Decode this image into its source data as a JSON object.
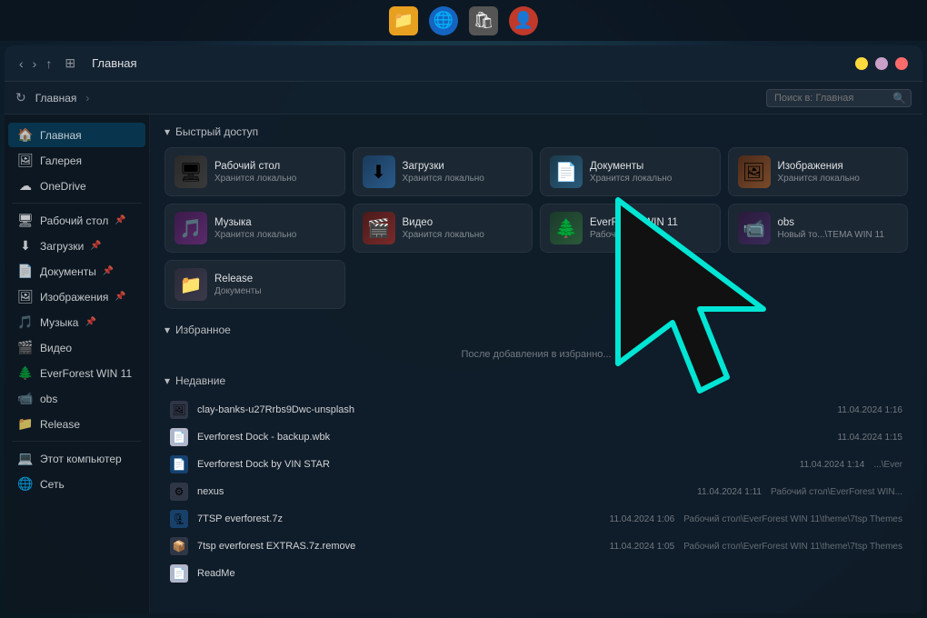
{
  "taskbar": {
    "icons": [
      {
        "name": "folder",
        "label": "📁",
        "type": "folder"
      },
      {
        "name": "edge",
        "label": "🌐",
        "type": "edge"
      },
      {
        "name": "store",
        "label": "🛍",
        "type": "store"
      },
      {
        "name": "avatar",
        "label": "👤",
        "type": "avatar"
      }
    ]
  },
  "window": {
    "title": "Главная",
    "address": "Главная",
    "search_placeholder": "Поиск в: Главная",
    "win_controls": {
      "close_color": "#ff6b6b",
      "min_color": "#ffd93d",
      "max_color": "#c8a0c8"
    }
  },
  "sidebar": {
    "items": [
      {
        "id": "home",
        "label": "Главная",
        "icon": "🏠",
        "active": true
      },
      {
        "id": "gallery",
        "label": "Галерея",
        "icon": "🖼",
        "active": false
      },
      {
        "id": "onedrive",
        "label": "OneDrive",
        "icon": "☁",
        "active": false
      }
    ],
    "pinned": [
      {
        "id": "desktop",
        "label": "Рабочий стол",
        "icon": "🖥",
        "pinned": true
      },
      {
        "id": "downloads",
        "label": "Загрузки",
        "icon": "⬇",
        "pinned": true
      },
      {
        "id": "documents",
        "label": "Документы",
        "icon": "📄",
        "pinned": true
      },
      {
        "id": "images",
        "label": "Изображения",
        "icon": "🖼",
        "pinned": true
      },
      {
        "id": "music",
        "label": "Музыка",
        "icon": "🎵",
        "pinned": true
      },
      {
        "id": "video",
        "label": "Видео",
        "icon": "🎬",
        "pinned": false
      },
      {
        "id": "everforest",
        "label": "EverForest WIN 11",
        "icon": "🌲",
        "pinned": false
      },
      {
        "id": "obs",
        "label": "obs",
        "icon": "📹",
        "pinned": false
      },
      {
        "id": "release",
        "label": "Release",
        "icon": "📁",
        "pinned": false
      }
    ],
    "computer": {
      "id": "computer",
      "label": "Этот компьютер",
      "icon": "💻"
    },
    "network": {
      "id": "network",
      "label": "Сеть",
      "icon": "🌐"
    }
  },
  "quick_access": {
    "section_label": "Быстрый доступ",
    "items": [
      {
        "id": "desktop",
        "name": "Рабочий стол",
        "sub": "Хранится локально",
        "icon": "🖥",
        "color": "fi-desktop"
      },
      {
        "id": "downloads",
        "name": "Загрузки",
        "sub": "Хранится локально",
        "icon": "⬇",
        "color": "fi-downloads"
      },
      {
        "id": "documents",
        "name": "Документы",
        "sub": "Хранится локально",
        "icon": "📄",
        "color": "fi-docs"
      },
      {
        "id": "images",
        "name": "Изображения",
        "sub": "Хранится локально",
        "icon": "🖼",
        "color": "fi-images"
      },
      {
        "id": "music",
        "name": "Музыка",
        "sub": "Хранится локально",
        "icon": "🎵",
        "color": "fi-music"
      },
      {
        "id": "video",
        "name": "Видео",
        "sub": "Хранится локально",
        "icon": "🎬",
        "color": "fi-video"
      },
      {
        "id": "everforest",
        "name": "EverForest WIN 11",
        "sub": "Рабочий стол",
        "icon": "🌲",
        "color": "fi-everforest"
      },
      {
        "id": "obs",
        "name": "obs",
        "sub": "Новый то...\\TEMA WIN 11",
        "icon": "📹",
        "color": "fi-obs"
      },
      {
        "id": "release",
        "name": "Release",
        "sub": "Документы",
        "icon": "📁",
        "color": "fi-release"
      }
    ]
  },
  "favorites": {
    "section_label": "Избранное",
    "empty_text": "После добавления в избранно..."
  },
  "recent": {
    "section_label": "Недавние",
    "items": [
      {
        "name": "clay-banks-u27Rrbs9Dwc-unsplash",
        "date": "11.04.2024 1:16",
        "path": "",
        "icon": "gray",
        "icon_char": "🖼"
      },
      {
        "name": "Everforest Dock - backup.wbk",
        "date": "11.04.2024 1:15",
        "path": "",
        "icon": "white",
        "icon_char": "📄"
      },
      {
        "name": "Everforest Dock by VIN STAR",
        "date": "11.04.2024 1:14",
        "path": "...\\Ever",
        "icon": "doc",
        "icon_char": "📄"
      },
      {
        "name": "nexus",
        "date": "11.04.2024 1:11",
        "path": "Рабочий стол\\EverForest WIN...",
        "icon": "gray",
        "icon_char": "⚙"
      },
      {
        "name": "7TSP everforest.7z",
        "date": "11.04.2024 1:06",
        "path": "Рабочий стол\\EverForest WIN 11\\theme\\7tsp Themes",
        "icon": "blue",
        "icon_char": "🗜"
      },
      {
        "name": "7tsp everforest EXTRAS.7z.remove",
        "date": "11.04.2024 1:05",
        "path": "Рабочий стол\\EverForest WIN 11\\theme\\7tsp Themes",
        "icon": "gray",
        "icon_char": "📦"
      },
      {
        "name": "ReadMe",
        "date": "",
        "path": "",
        "icon": "white",
        "icon_char": "📄"
      }
    ]
  }
}
